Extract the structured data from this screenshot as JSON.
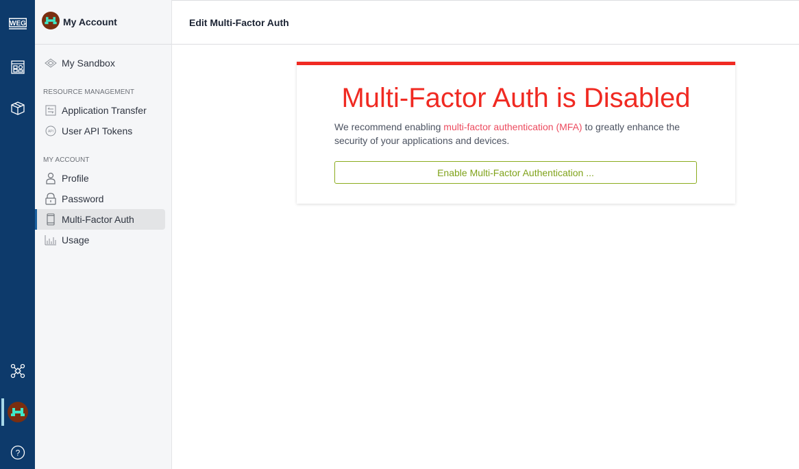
{
  "app": {
    "logo_text": "WEG",
    "rail_icons": [
      "dashboard-icon",
      "package-icon",
      "network-icon",
      "user-avatar",
      "help-icon"
    ]
  },
  "subnav": {
    "title": "My Account",
    "top_items": [
      {
        "label": "My Sandbox",
        "icon": "sandbox-icon"
      }
    ],
    "sections": [
      {
        "label": "RESOURCE MANAGEMENT",
        "items": [
          {
            "label": "Application Transfer",
            "icon": "transfer-icon"
          },
          {
            "label": "User API Tokens",
            "icon": "api-icon"
          }
        ]
      },
      {
        "label": "MY ACCOUNT",
        "items": [
          {
            "label": "Profile",
            "icon": "person-icon"
          },
          {
            "label": "Password",
            "icon": "lock-icon"
          },
          {
            "label": "Multi-Factor Auth",
            "icon": "phone-icon",
            "active": true
          },
          {
            "label": "Usage",
            "icon": "chart-icon"
          }
        ]
      }
    ]
  },
  "header": {
    "title": "Edit Multi-Factor Auth"
  },
  "card": {
    "heading": "Multi-Factor Auth is Disabled",
    "text_before": "We recommend enabling ",
    "link_text": "multi-factor authentication (MFA)",
    "text_after": " to greatly enhance the security of your applications and devices.",
    "button_label": "Enable Multi-Factor Authentication ...",
    "accent_color": "#f02a22",
    "button_color": "#7fa219"
  }
}
